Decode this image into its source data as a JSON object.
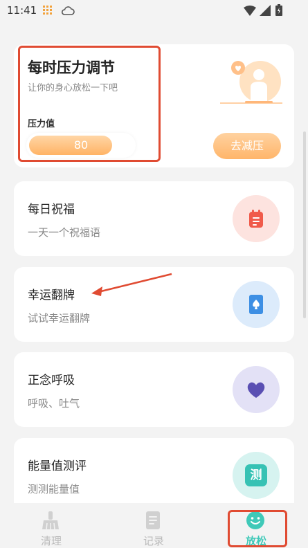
{
  "status_bar": {
    "time": "11:41"
  },
  "stress_card": {
    "title": "每时压力调节",
    "subtitle": "让你的身心放松一下吧",
    "stress_label": "压力值",
    "stress_value": "80",
    "stress_level": 0.8,
    "action_label": "去减压"
  },
  "features": [
    {
      "title": "每日祝福",
      "subtitle": "一天一个祝福语",
      "icon": "notepad-icon",
      "circle_color": "#fde3df",
      "icon_color": "#f05a4a"
    },
    {
      "title": "幸运翻牌",
      "subtitle": "试试幸运翻牌",
      "icon": "spade-card-icon",
      "circle_color": "#dcebfb",
      "icon_color": "#3d8fe4"
    },
    {
      "title": "正念呼吸",
      "subtitle": "呼吸、吐气",
      "icon": "heart-icon",
      "circle_color": "#e3e1f6",
      "icon_color": "#5a4fb3"
    },
    {
      "title": "能量值测评",
      "subtitle": "测测能量值",
      "icon": "test-icon",
      "icon_text": "测",
      "circle_color": "#d6f3f0",
      "icon_color": "#36c2b4"
    }
  ],
  "tabbar": {
    "tabs": [
      {
        "label": "清理",
        "icon": "broom-icon"
      },
      {
        "label": "记录",
        "icon": "document-icon"
      },
      {
        "label": "放松",
        "icon": "smile-icon",
        "active": true
      }
    ]
  },
  "colors": {
    "accent_orange": "#ffb365",
    "active_teal": "#3fc9b8",
    "highlight_red": "#e04b32"
  }
}
